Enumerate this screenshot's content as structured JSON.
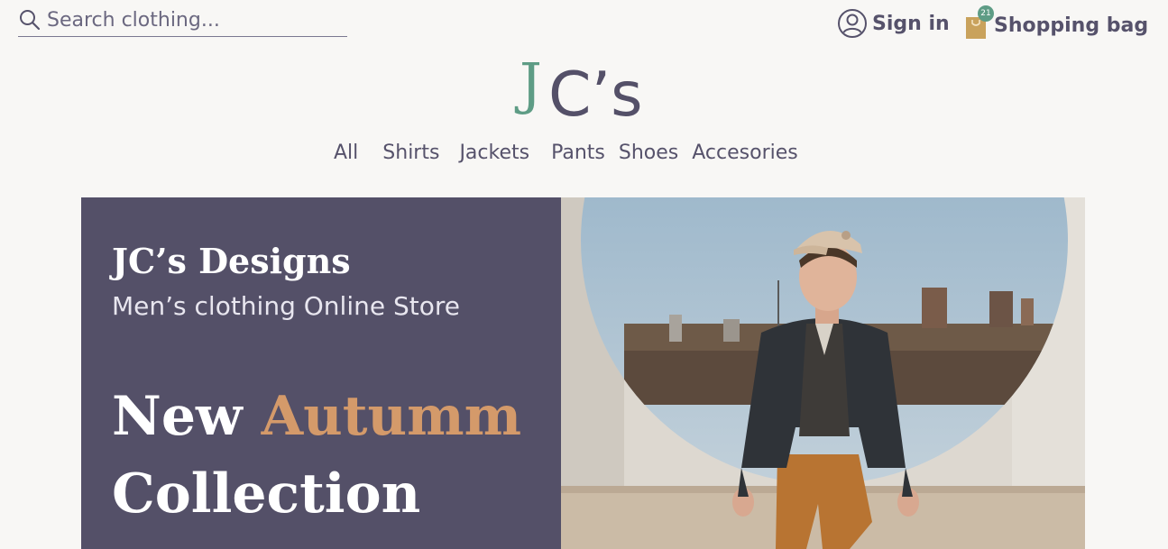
{
  "search": {
    "placeholder": "Search clothing..."
  },
  "account": {
    "signin_label": "Sign in"
  },
  "bag": {
    "label": "Shopping bag",
    "count": "21"
  },
  "logo": {
    "j": "J",
    "rest": "C’s"
  },
  "nav": {
    "all": "All",
    "shirts": "Shirts",
    "jackets": "Jackets",
    "pants": "Pants",
    "shoes": "Shoes",
    "accessories": "Accesories"
  },
  "hero": {
    "title": "JC’s Designs",
    "subtitle": "Men’s clothing Online Store",
    "headline_word1": "New",
    "headline_accent": "Autumm",
    "headline_line2": "Collection"
  },
  "colors": {
    "brand_purple": "#545068",
    "brand_green": "#5e9c85",
    "accent_tan": "#d49a6a",
    "background": "#f8f7f5"
  }
}
